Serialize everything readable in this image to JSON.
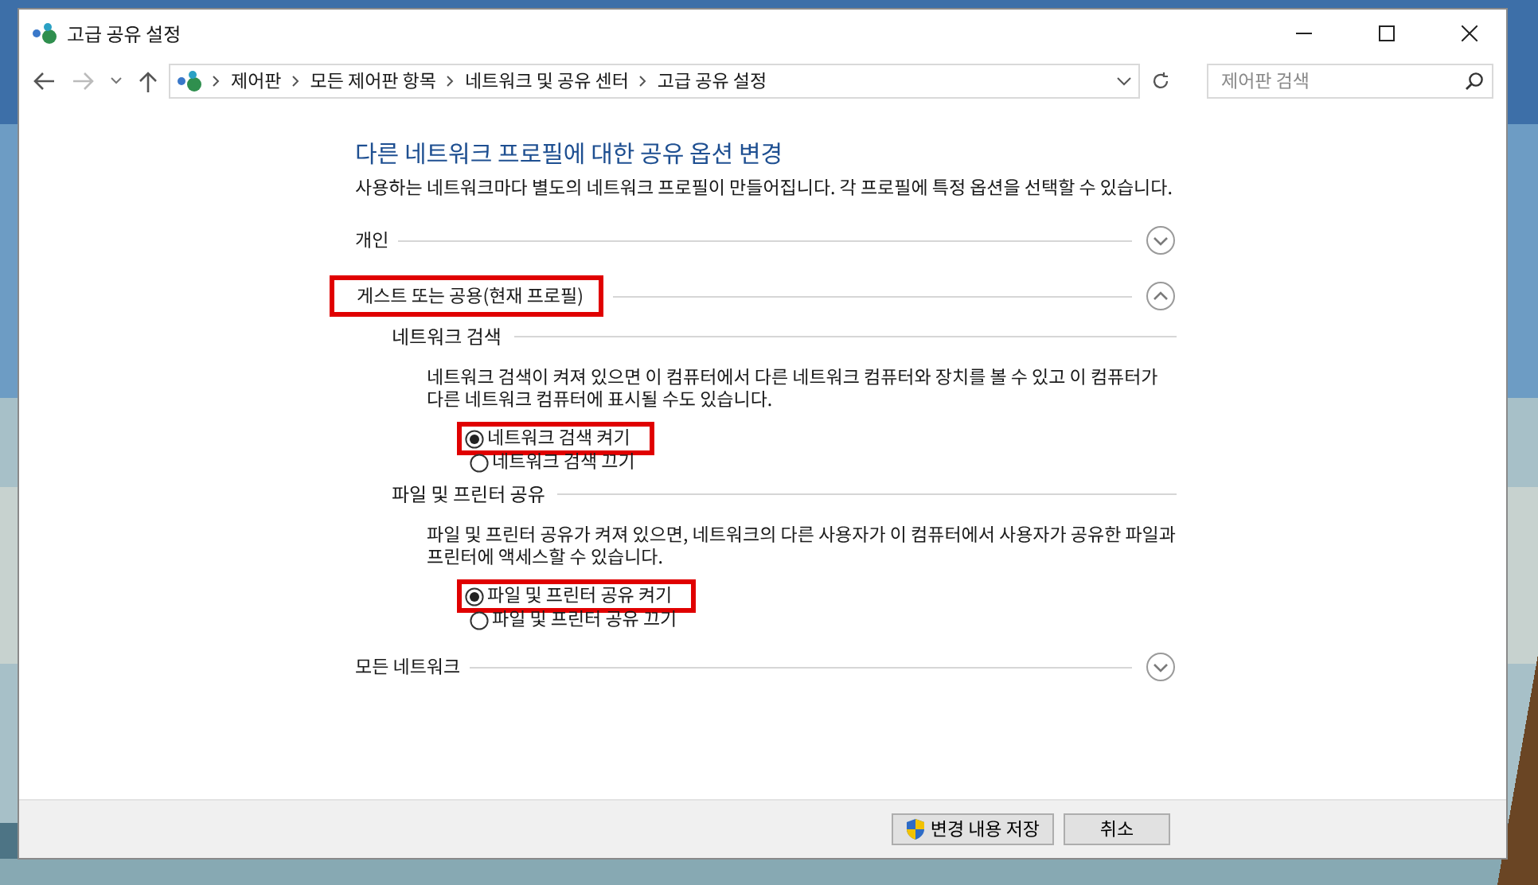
{
  "window": {
    "title": "고급 공유 설정"
  },
  "address_bar": {
    "path": [
      "제어판",
      "모든 제어판 항목",
      "네트워크 및 공유 센터",
      "고급 공유 설정"
    ]
  },
  "search": {
    "placeholder": "제어판 검색"
  },
  "heading": "다른 네트워크 프로필에 대한 공유 옵션 변경",
  "description": "사용하는 네트워크마다 별도의 네트워크 프로필이 만들어집니다. 각 프로필에 특정 옵션을 선택할 수 있습니다.",
  "profiles": [
    {
      "name": "개인",
      "expanded": false,
      "highlighted": false
    },
    {
      "name": "게스트 또는 공용(현재 프로필)",
      "expanded": true,
      "highlighted": true,
      "sections": [
        {
          "title": "네트워크 검색",
          "description": "네트워크 검색이 켜져 있으면 이 컴퓨터에서 다른 네트워크 컴퓨터와 장치를 볼 수 있고 이 컴퓨터가 다른 네트워크 컴퓨터에 표시될 수도 있습니다.",
          "options": [
            {
              "label": "네트워크 검색 켜기",
              "selected": true,
              "highlighted": true
            },
            {
              "label": "네트워크 검색 끄기",
              "selected": false,
              "highlighted": false
            }
          ]
        },
        {
          "title": "파일 및 프린터 공유",
          "description": "파일 및 프린터 공유가 켜져 있으면, 네트워크의 다른 사용자가 이 컴퓨터에서 사용자가 공유한 파일과 프린터에 액세스할 수 있습니다.",
          "options": [
            {
              "label": "파일 및 프린터 공유 켜기",
              "selected": true,
              "highlighted": true
            },
            {
              "label": "파일 및 프린터 공유 끄기",
              "selected": false,
              "highlighted": false
            }
          ]
        }
      ]
    },
    {
      "name": "모든 네트워크",
      "expanded": false,
      "highlighted": false
    }
  ],
  "buttons": [
    {
      "label": "변경 내용 저장",
      "kind": "shield"
    },
    {
      "label": "취소",
      "kind": "plain"
    }
  ]
}
